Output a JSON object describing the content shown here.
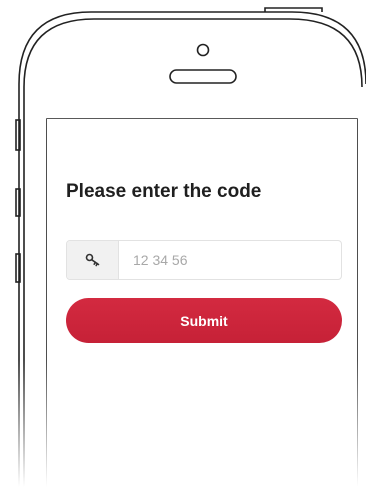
{
  "verify": {
    "title": "Please enter the code",
    "code_placeholder": "12 34 56",
    "code_value": "",
    "submit_label": "Submit"
  },
  "icons": {
    "field_addon": "key-icon"
  },
  "colors": {
    "accent": "#cc2539",
    "outline": "#222222",
    "addon_bg": "#f1f1f1",
    "border": "#e2e2e2"
  }
}
